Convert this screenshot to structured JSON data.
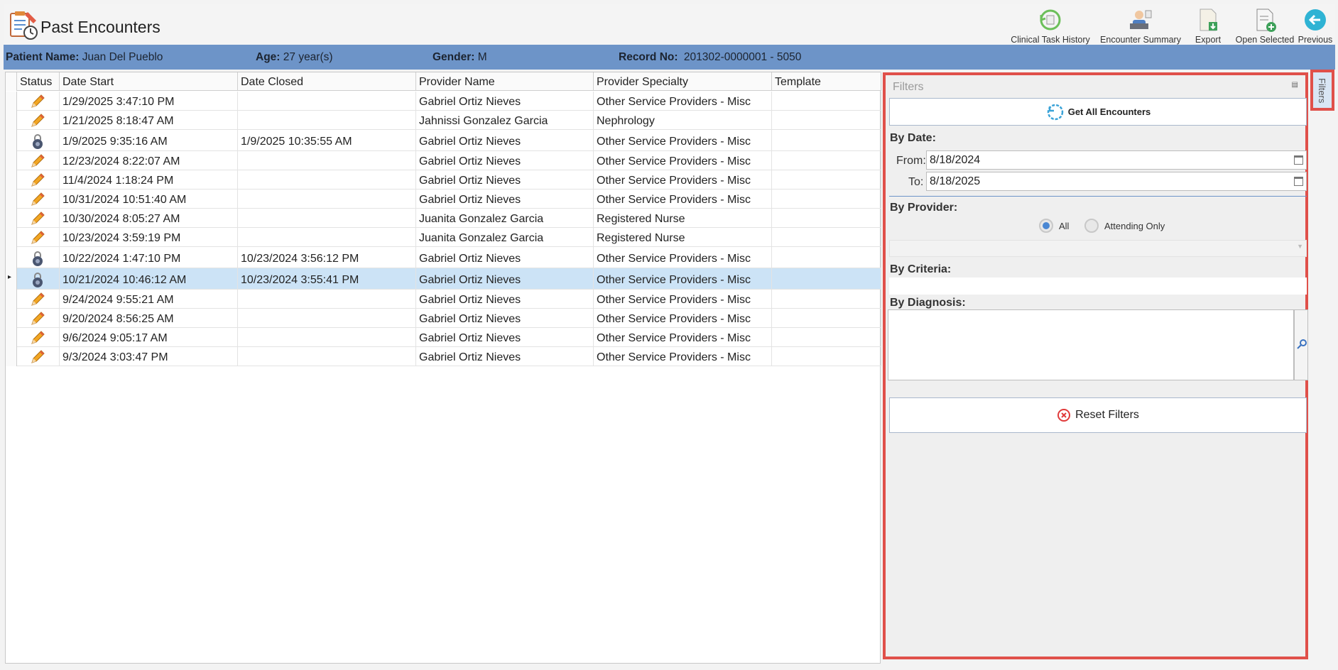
{
  "window": {
    "title": "Past Encounters"
  },
  "toolbar": {
    "clinical_task_history": "Clinical Task History",
    "encounter_summary": "Encounter Summary",
    "export": "Export",
    "open_selected": "Open Selected",
    "previous": "Previous"
  },
  "patient": {
    "name_label": "Patient Name:",
    "name": "Juan Del Pueblo",
    "age_label": "Age:",
    "age": "27 year(s)",
    "gender_label": "Gender:",
    "gender": "M",
    "record_label": "Record No:",
    "record": "201302-0000001 - 5050"
  },
  "grid": {
    "columns": [
      "Status",
      "Date Start",
      "Date Closed",
      "Provider Name",
      "Provider Specialty",
      "Template"
    ],
    "rows": [
      {
        "status": "open",
        "date_start": "1/29/2025 3:47:10 PM",
        "date_closed": "",
        "provider": "Gabriel Ortiz Nieves",
        "specialty": "Other Service Providers - Misc",
        "template": ""
      },
      {
        "status": "open",
        "date_start": "1/21/2025 8:18:47 AM",
        "date_closed": "",
        "provider": "Jahnissi Gonzalez Garcia",
        "specialty": "Nephrology",
        "template": ""
      },
      {
        "status": "locked",
        "date_start": "1/9/2025 9:35:16 AM",
        "date_closed": "1/9/2025 10:35:55 AM",
        "provider": "Gabriel Ortiz Nieves",
        "specialty": "Other Service Providers - Misc",
        "template": ""
      },
      {
        "status": "open",
        "date_start": "12/23/2024 8:22:07 AM",
        "date_closed": "",
        "provider": "Gabriel Ortiz Nieves",
        "specialty": "Other Service Providers - Misc",
        "template": ""
      },
      {
        "status": "open",
        "date_start": "11/4/2024 1:18:24 PM",
        "date_closed": "",
        "provider": "Gabriel Ortiz Nieves",
        "specialty": "Other Service Providers - Misc",
        "template": ""
      },
      {
        "status": "open",
        "date_start": "10/31/2024 10:51:40 AM",
        "date_closed": "",
        "provider": "Gabriel Ortiz Nieves",
        "specialty": "Other Service Providers - Misc",
        "template": ""
      },
      {
        "status": "open",
        "date_start": "10/30/2024 8:05:27 AM",
        "date_closed": "",
        "provider": "Juanita Gonzalez Garcia",
        "specialty": "Registered Nurse",
        "template": ""
      },
      {
        "status": "open",
        "date_start": "10/23/2024 3:59:19 PM",
        "date_closed": "",
        "provider": "Juanita Gonzalez Garcia",
        "specialty": "Registered Nurse",
        "template": ""
      },
      {
        "status": "locked",
        "date_start": "10/22/2024 1:47:10 PM",
        "date_closed": "10/23/2024 3:56:12 PM",
        "provider": "Gabriel Ortiz Nieves",
        "specialty": "Other Service Providers - Misc",
        "template": ""
      },
      {
        "status": "locked",
        "date_start": "10/21/2024 10:46:12 AM",
        "date_closed": "10/23/2024 3:55:41 PM",
        "provider": "Gabriel Ortiz Nieves",
        "specialty": "Other Service Providers - Misc",
        "template": "",
        "selected": true
      },
      {
        "status": "open",
        "date_start": "9/24/2024 9:55:21 AM",
        "date_closed": "",
        "provider": "Gabriel Ortiz Nieves",
        "specialty": "Other Service Providers - Misc",
        "template": ""
      },
      {
        "status": "open",
        "date_start": "9/20/2024 8:56:25 AM",
        "date_closed": "",
        "provider": "Gabriel Ortiz Nieves",
        "specialty": "Other Service Providers - Misc",
        "template": ""
      },
      {
        "status": "open",
        "date_start": "9/6/2024 9:05:17 AM",
        "date_closed": "",
        "provider": "Gabriel Ortiz Nieves",
        "specialty": "Other Service Providers - Misc",
        "template": ""
      },
      {
        "status": "open",
        "date_start": "9/3/2024 3:03:47 PM",
        "date_closed": "",
        "provider": "Gabriel Ortiz Nieves",
        "specialty": "Other Service Providers - Misc",
        "template": ""
      }
    ]
  },
  "filters": {
    "title": "Filters",
    "get_all": "Get All Encounters",
    "by_date": "By Date:",
    "from_label": "From:",
    "from_value": "8/18/2024",
    "to_label": "To:",
    "to_value": "8/18/2025",
    "by_provider": "By Provider:",
    "all_label": "All",
    "attending_label": "Attending Only",
    "provider_selected": "All",
    "by_criteria": "By Criteria:",
    "by_diagnosis": "By Diagnosis:",
    "reset": "Reset Filters",
    "tab_label": "Filters"
  },
  "colors": {
    "header_bar": "#6d94c8",
    "selected_row": "#cce3f6",
    "highlight_border": "#e0504a",
    "radio_on": "#4a87d3"
  }
}
